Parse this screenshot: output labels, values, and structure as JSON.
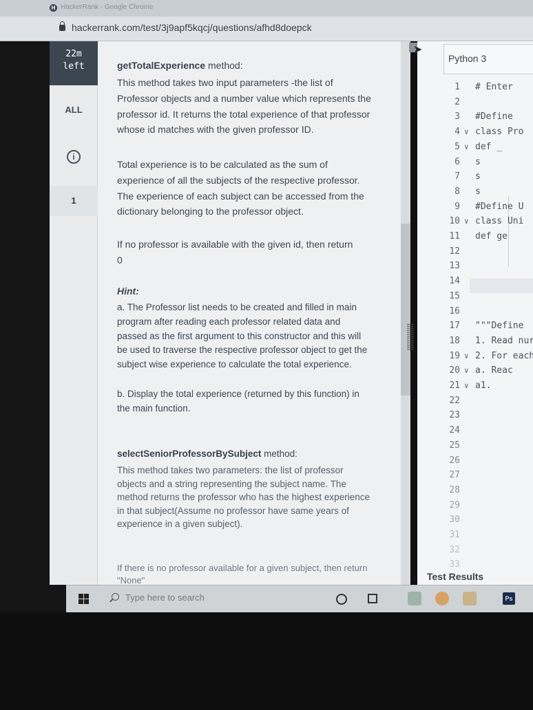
{
  "browser": {
    "tab_title": "HackerRank - Google Chrome",
    "url": "hackerrank.com/test/3j9apf5kqcj/questions/afhd8doepck"
  },
  "rail": {
    "timer": "22m",
    "timer_unit": "left",
    "all_label": "ALL",
    "info_icon": "info-icon",
    "question_number": "1"
  },
  "problem": {
    "method1_name": "getTotalExperience",
    "method1_suffix": " method:",
    "method1_desc": "This method takes two input parameters -the list of Professor objects and a number value which represents the professor id. It returns the total experience of that professor whose id matches with the given professor ID.",
    "method1_calc": "Total experience is to be calculated as the sum of experience of all the subjects of the respective professor. The experience of each subject can be accessed from the dictionary belonging to the professor object.",
    "method1_none": "If no professor is available with the given id, then return 0",
    "hint_label": "Hint:",
    "hint_a": "a. The Professor list needs to be created and filled in main program after reading each professor related data and passed as the first argument to this constructor and this will be used to traverse the respective professor object to get the subject wise experience to calculate the total experience.",
    "hint_b": "b. Display the total experience (returned by this function) in the main function.",
    "method2_name": "selectSeniorProfessorBySubject",
    "method2_suffix": " method:",
    "method2_desc": "This method takes two parameters: the list of professor objects and a string representing the subject name. The method returns the professor who has the highest experience in that subject(Assume no professor have same years of experience in a given subject).",
    "method2_none": "If there is no professor available for a given subject, then return \"None\""
  },
  "editor": {
    "language": "Python 3",
    "lines": [
      {
        "n": "1",
        "fold": "",
        "code": "# Enter"
      },
      {
        "n": "2",
        "fold": "",
        "code": ""
      },
      {
        "n": "3",
        "fold": "",
        "code": "#Define"
      },
      {
        "n": "4",
        "fold": "∨",
        "code": "class Pro"
      },
      {
        "n": "5",
        "fold": "∨",
        "code": "    def _"
      },
      {
        "n": "6",
        "fold": "",
        "code": "        s"
      },
      {
        "n": "7",
        "fold": "",
        "code": "        s"
      },
      {
        "n": "8",
        "fold": "",
        "code": "        s"
      },
      {
        "n": "9",
        "fold": "",
        "code": "#Define U"
      },
      {
        "n": "10",
        "fold": "∨",
        "code": "class Uni"
      },
      {
        "n": "11",
        "fold": "",
        "code": "    def ge"
      },
      {
        "n": "12",
        "fold": "",
        "code": ""
      },
      {
        "n": "13",
        "fold": "",
        "code": ""
      },
      {
        "n": "14",
        "fold": "",
        "code": ""
      },
      {
        "n": "15",
        "fold": "",
        "code": ""
      },
      {
        "n": "16",
        "fold": "",
        "code": ""
      },
      {
        "n": "17",
        "fold": "",
        "code": "\"\"\"Define"
      },
      {
        "n": "18",
        "fold": "",
        "code": "1. Read nur"
      },
      {
        "n": "19",
        "fold": "∨",
        "code": "2. For each"
      },
      {
        "n": "20",
        "fold": "∨",
        "code": "    a. Reac"
      },
      {
        "n": "21",
        "fold": "∨",
        "code": "        a1."
      },
      {
        "n": "22",
        "fold": "",
        "code": ""
      },
      {
        "n": "23",
        "fold": "",
        "code": ""
      },
      {
        "n": "24",
        "fold": "",
        "code": ""
      },
      {
        "n": "25",
        "fold": "",
        "code": ""
      },
      {
        "n": "26",
        "fold": "",
        "code": ""
      },
      {
        "n": "27",
        "fold": "",
        "code": ""
      },
      {
        "n": "28",
        "fold": "",
        "code": ""
      },
      {
        "n": "29",
        "fold": "",
        "code": ""
      },
      {
        "n": "30",
        "fold": "",
        "code": ""
      },
      {
        "n": "31",
        "fold": "",
        "code": ""
      },
      {
        "n": "32",
        "fold": "",
        "code": ""
      },
      {
        "n": "33",
        "fold": "",
        "code": ""
      }
    ],
    "test_results_label": "Test Results"
  },
  "taskbar": {
    "search_placeholder": "Type here to search",
    "ps_label": "Ps"
  }
}
